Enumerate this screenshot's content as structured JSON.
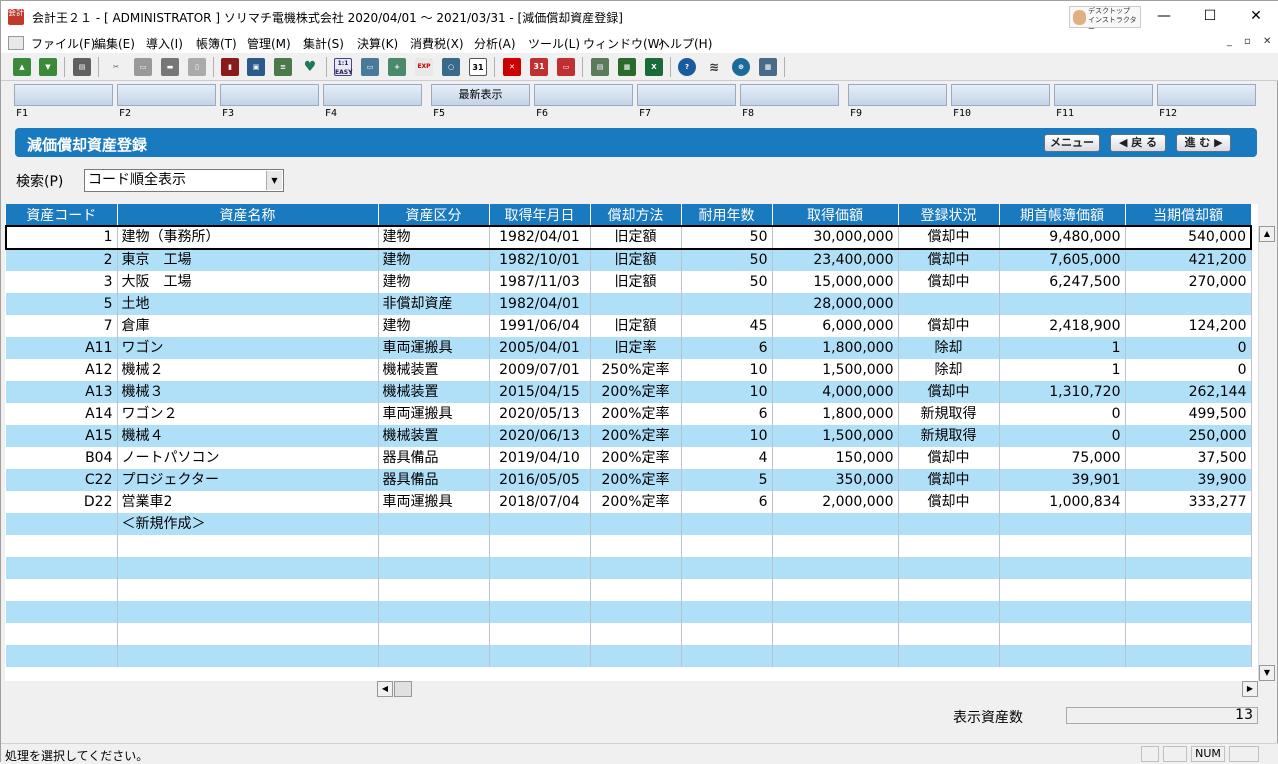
{
  "window": {
    "title": "会計王２１ - [ ADMINISTRATOR ] ソリマチ電機株式会社 2020/04/01 〜 2021/03/31 - [減価償却資産登録]",
    "app_icon_text": "会計",
    "instructor_label_1": "デスクトップ",
    "instructor_label_2": "インストラクター",
    "minimize": "—",
    "maximize": "☐",
    "close": "✕"
  },
  "menu": {
    "items": [
      "ファイル(F)",
      "編集(E)",
      "導入(I)",
      "帳簿(T)",
      "管理(M)",
      "集計(S)",
      "決算(K)",
      "消費税(X)",
      "分析(A)",
      "ツール(L)",
      "ウィンドウ(W)",
      "ヘルプ(H)"
    ],
    "mdi_min": "_",
    "mdi_restore": "▫",
    "mdi_close": "✕"
  },
  "toolbar": {
    "icons": [
      "import-icon",
      "export-icon",
      "print-setup-icon",
      "cut-icon",
      "copy-icon",
      "paste-icon",
      "clipboard-icon",
      "book-icon",
      "ledger-icon",
      "edit-icon",
      "heart-icon",
      "easy-entry-icon",
      "journal-icon",
      "add-icon",
      "exp-icon",
      "budget-icon",
      "calendar-icon",
      "delete-icon",
      "calendar-add-icon",
      "calendar-remove-icon",
      "report-icon",
      "table-icon",
      "excel-icon",
      "help-icon",
      "layers-icon",
      "web-icon",
      "calculator-icon"
    ]
  },
  "fkeys": {
    "buttons": [
      "",
      "",
      "",
      "",
      "最新表示",
      "",
      "",
      "",
      "",
      "",
      "",
      ""
    ],
    "labels": [
      "F1",
      "F2",
      "F3",
      "F4",
      "F5",
      "F6",
      "F7",
      "F8",
      "F9",
      "F10",
      "F11",
      "F12"
    ]
  },
  "header": {
    "title": "減価償却資産登録",
    "menu_btn": "メニュー",
    "back_btn": "◀ 戻 る",
    "forward_btn": "進 む ▶"
  },
  "search": {
    "label": "検索(P)",
    "value": "コード順全表示"
  },
  "table": {
    "columns": [
      "資産コード",
      "資産名称",
      "資産区分",
      "取得年月日",
      "償却方法",
      "耐用年数",
      "取得価額",
      "登録状況",
      "期首帳簿価額",
      "当期償却額"
    ],
    "rows": [
      [
        "1",
        "建物（事務所）",
        "建物",
        "1982/04/01",
        "旧定額",
        "50",
        "30,000,000",
        "償却中",
        "9,480,000",
        "540,000"
      ],
      [
        "2",
        "東京　工場",
        "建物",
        "1982/10/01",
        "旧定額",
        "50",
        "23,400,000",
        "償却中",
        "7,605,000",
        "421,200"
      ],
      [
        "3",
        "大阪　工場",
        "建物",
        "1987/11/03",
        "旧定額",
        "50",
        "15,000,000",
        "償却中",
        "6,247,500",
        "270,000"
      ],
      [
        "5",
        "土地",
        "非償却資産",
        "1982/04/01",
        "",
        "",
        "28,000,000",
        "",
        "",
        ""
      ],
      [
        "7",
        "倉庫",
        "建物",
        "1991/06/04",
        "旧定額",
        "45",
        "6,000,000",
        "償却中",
        "2,418,900",
        "124,200"
      ],
      [
        "A11",
        "ワゴン",
        "車両運搬具",
        "2005/04/01",
        "旧定率",
        "6",
        "1,800,000",
        "除却",
        "1",
        "0"
      ],
      [
        "A12",
        "機械２",
        "機械装置",
        "2009/07/01",
        "250%定率",
        "10",
        "1,500,000",
        "除却",
        "1",
        "0"
      ],
      [
        "A13",
        "機械３",
        "機械装置",
        "2015/04/15",
        "200%定率",
        "10",
        "4,000,000",
        "償却中",
        "1,310,720",
        "262,144"
      ],
      [
        "A14",
        "ワゴン２",
        "車両運搬具",
        "2020/05/13",
        "200%定率",
        "6",
        "1,800,000",
        "新規取得",
        "0",
        "499,500"
      ],
      [
        "A15",
        "機械４",
        "機械装置",
        "2020/06/13",
        "200%定率",
        "10",
        "1,500,000",
        "新規取得",
        "0",
        "250,000"
      ],
      [
        "B04",
        "ノートパソコン",
        "器具備品",
        "2019/04/10",
        "200%定率",
        "4",
        "150,000",
        "償却中",
        "75,000",
        "37,500"
      ],
      [
        "C22",
        "プロジェクター",
        "器具備品",
        "2016/05/05",
        "200%定率",
        "5",
        "350,000",
        "償却中",
        "39,901",
        "39,900"
      ],
      [
        "D22",
        "営業車2",
        "車両運搬具",
        "2018/07/04",
        "200%定率",
        "6",
        "2,000,000",
        "償却中",
        "1,000,834",
        "333,277"
      ],
      [
        "",
        "＜新規作成＞",
        "",
        "",
        "",
        "",
        "",
        "",
        "",
        ""
      ]
    ]
  },
  "footer": {
    "count_label": "表示資産数",
    "count_value": "13"
  },
  "status": {
    "message": "処理を選択してください。",
    "num": "NUM"
  }
}
